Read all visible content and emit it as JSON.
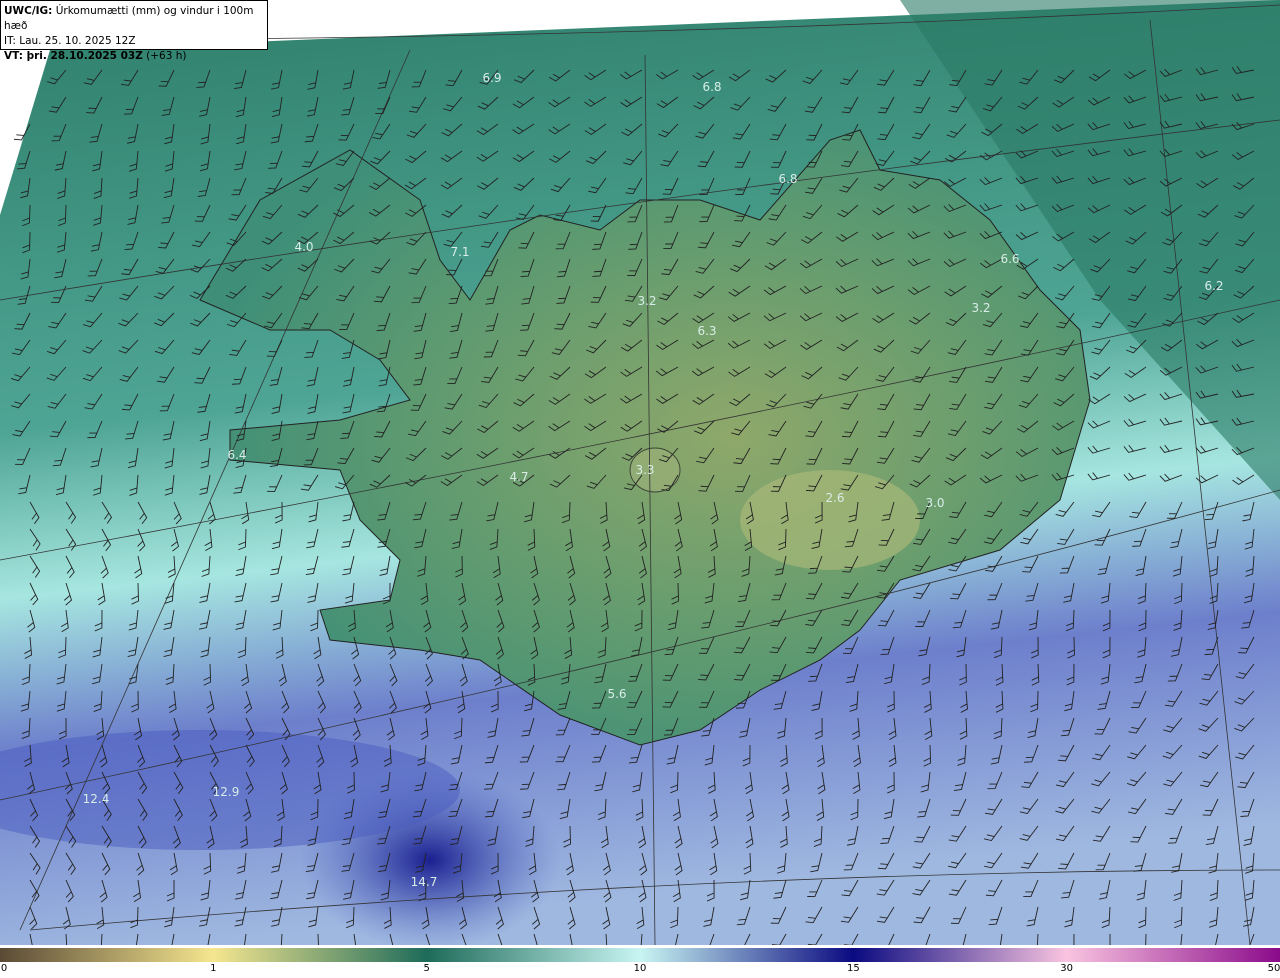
{
  "title": {
    "model": "UWC/IG:",
    "description": "Úrkomumætti (mm) og vindur i 100m hæð",
    "initial_time": "IT: Lau. 25. 10. 2025 12Z",
    "valid_label": "VT: þri. 28.10.2025 03Z",
    "lead": "(+63 h)"
  },
  "map_values": [
    "6.9",
    "6.8",
    "6.8",
    "4.0",
    "7.1",
    "6.6",
    "6.2",
    "3.2",
    "6.3",
    "3.2",
    "6.4",
    "4.7",
    "3.3",
    "2.6",
    "3.0",
    "5.6",
    "12.4",
    "12.9",
    "14.7"
  ],
  "colorbar": {
    "unit": "mm",
    "ticks": [
      "0",
      "1",
      "5",
      "10",
      "15",
      "30",
      "50"
    ],
    "colors": [
      "#5a4a35",
      "#f5e68f",
      "#1e6b5a",
      "#c8f5f2",
      "#0a0a80",
      "#f9c4e0",
      "#8a0a8a"
    ]
  }
}
